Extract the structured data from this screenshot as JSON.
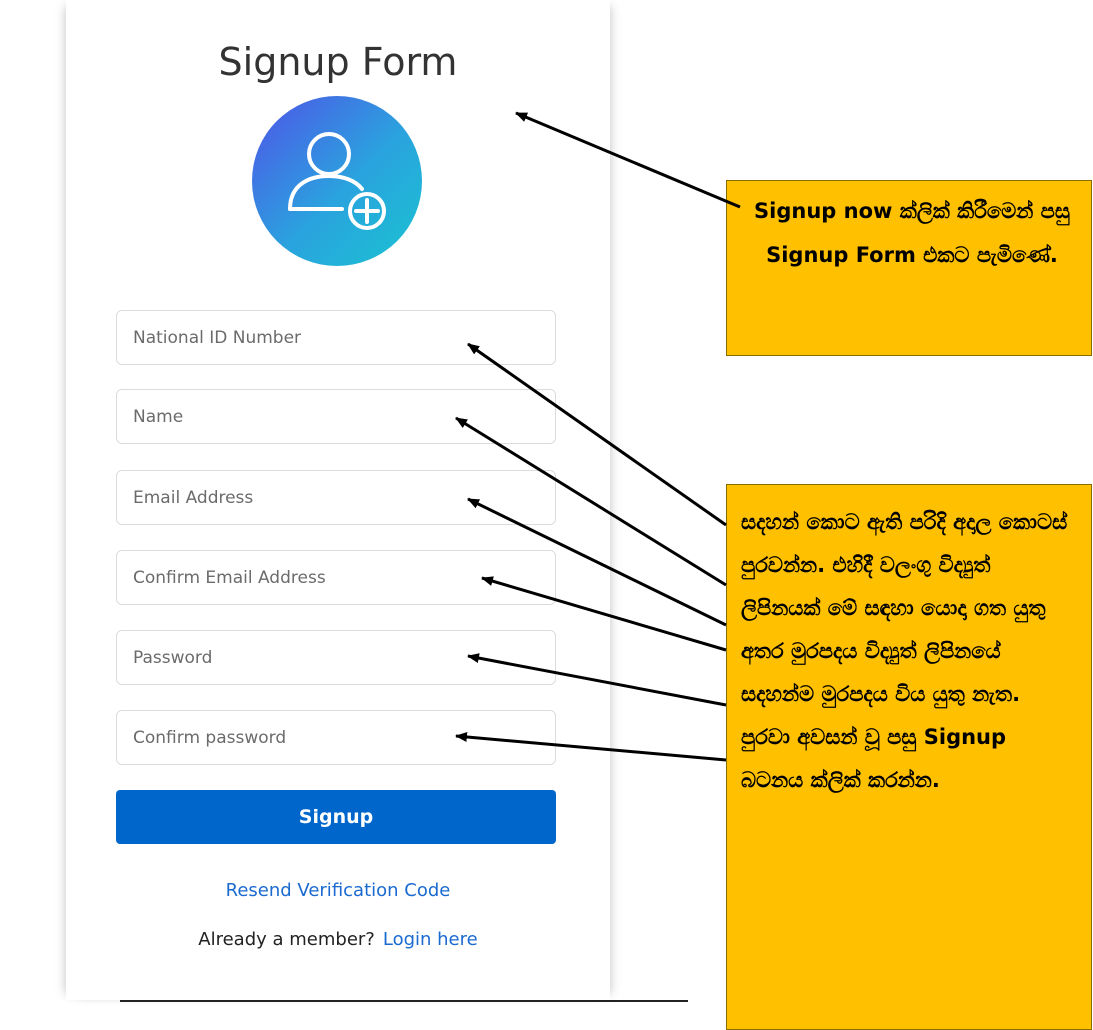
{
  "form": {
    "title": "Signup Form",
    "avatar_icon": "add-user-icon",
    "fields": {
      "national_id": "National ID Number",
      "name": "Name",
      "email": "Email Address",
      "confirm_email": "Confirm Email Address",
      "password": "Password",
      "confirm_password": "Confirm password"
    },
    "signup_label": "Signup",
    "resend_label": "Resend Verification Code",
    "member_text": "Already a member?",
    "login_label": "Login here",
    "colors": {
      "button": "#0066cc",
      "link": "#1a6ad0"
    }
  },
  "callouts": {
    "top": "Signup now ක්ලික් කිරීමෙන් පසු Signup Form එකට පැමිණේ.",
    "bottom": "සදහන් කොට ඇති පරිදි අදාල කොටස් පුරවන්න. එහිදී වලංගු විද්‍යුත් ලිපිනයක් මේ සඳහා යොදා ගත යුතු අතර මුරපදය විද්‍යුත් ලිපිනයේ සදහන්ම මුරපදය විය යුතු නැත. පුරවා අවසන් වූ පසු Signup බටනය ක්ලික් කරන්න.",
    "color": "#ffc000"
  }
}
